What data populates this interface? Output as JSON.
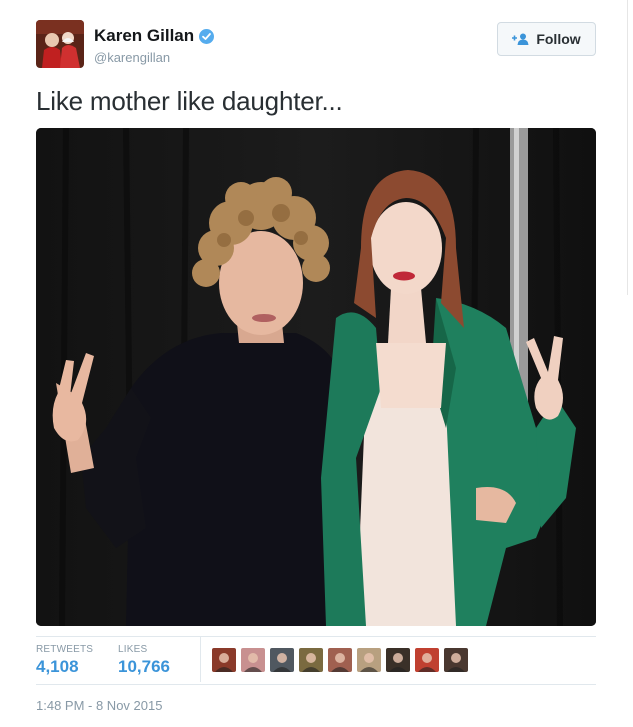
{
  "user": {
    "display_name": "Karen Gillan",
    "handle": "@karengillan",
    "verified": true
  },
  "follow_button": {
    "label": "Follow",
    "icon": "add-person-icon"
  },
  "tweet": {
    "text": "Like mother like daughter...",
    "photo_icon": "photo-image"
  },
  "stats": {
    "retweets_label": "RETWEETS",
    "retweets_value": "4,108",
    "likes_label": "LIKES",
    "likes_value": "10,766"
  },
  "likers": [
    {
      "color": "#8a3a2a"
    },
    {
      "color": "#c89090"
    },
    {
      "color": "#505860"
    },
    {
      "color": "#7a6a40"
    },
    {
      "color": "#a06050"
    },
    {
      "color": "#b8a080"
    },
    {
      "color": "#3a3028"
    },
    {
      "color": "#c04030"
    },
    {
      "color": "#4a3830"
    }
  ],
  "timestamp": "1:48 PM - 8 Nov 2015",
  "colors": {
    "accent": "#3b94d9",
    "verified": "#55acee",
    "muted": "#8899a6"
  }
}
